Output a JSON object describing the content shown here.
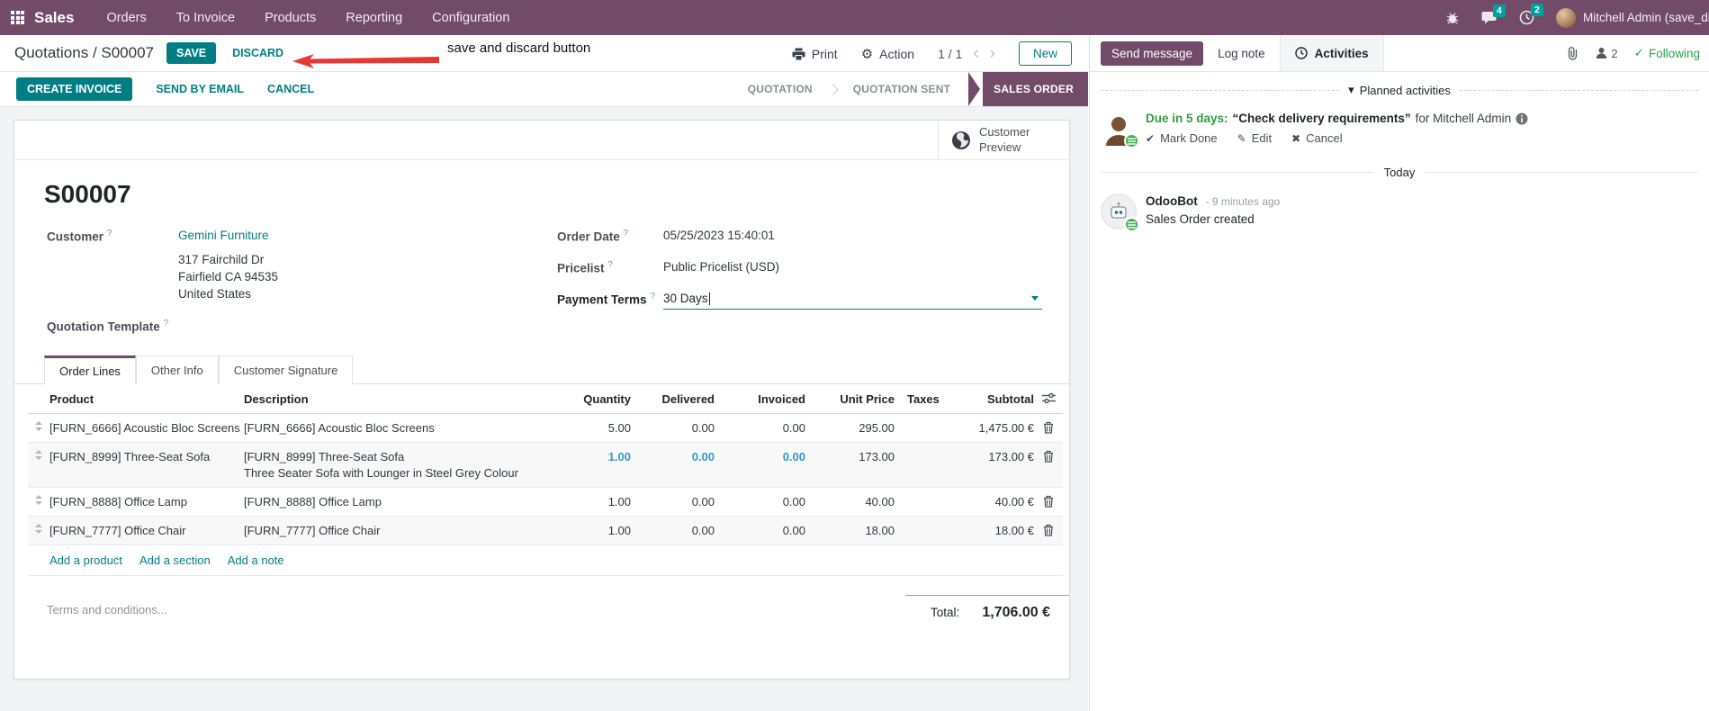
{
  "colors": {
    "brand": "#714B67",
    "primary": "#017E84",
    "success": "#28a745",
    "badge": "#00A09D",
    "edited_value": "#2E9DC6",
    "annotation": "#E53935"
  },
  "topnav": {
    "app": "Sales",
    "menus": [
      "Orders",
      "To Invoice",
      "Products",
      "Reporting",
      "Configuration"
    ],
    "message_badge": "4",
    "activity_badge": "2",
    "user": "Mitchell Admin (save_discar"
  },
  "control": {
    "breadcrumb": "Quotations / S00007",
    "save": "SAVE",
    "discard": "DISCARD",
    "annotation": "save and discard button",
    "print": "Print",
    "action": "Action",
    "pager": "1 / 1",
    "new": "New"
  },
  "actionbar": {
    "create_invoice": "CREATE INVOICE",
    "send_by_email": "SEND BY EMAIL",
    "cancel": "CANCEL",
    "stages": [
      "QUOTATION",
      "QUOTATION SENT",
      "SALES ORDER"
    ]
  },
  "form": {
    "preview_button": "Customer Preview",
    "title": "S00007",
    "customer": {
      "label": "Customer",
      "help": "?",
      "name": "Gemini Furniture",
      "address1": "317 Fairchild Dr",
      "address2": "Fairfield CA 94535",
      "address3": "United States"
    },
    "quotation_template": {
      "label": "Quotation Template",
      "help": "?"
    },
    "order_date": {
      "label": "Order Date",
      "help": "?",
      "value": "05/25/2023 15:40:01"
    },
    "pricelist": {
      "label": "Pricelist",
      "help": "?",
      "value": "Public Pricelist (USD)"
    },
    "payment_terms": {
      "label": "Payment Terms",
      "help": "?",
      "value": "30 Days"
    },
    "tabs": [
      "Order Lines",
      "Other Info",
      "Customer Signature"
    ],
    "table": {
      "headers": {
        "product": "Product",
        "description": "Description",
        "quantity": "Quantity",
        "delivered": "Delivered",
        "invoiced": "Invoiced",
        "unit_price": "Unit Price",
        "taxes": "Taxes",
        "subtotal": "Subtotal"
      },
      "rows": [
        {
          "product": "[FURN_6666] Acoustic Bloc Screens",
          "desc1": "[FURN_6666] Acoustic Bloc Screens",
          "desc2": "",
          "qty": "5.00",
          "delivered": "0.00",
          "invoiced": "0.00",
          "unit": "295.00",
          "taxes": "",
          "subtotal": "1,475.00 €"
        },
        {
          "product": "[FURN_8999] Three-Seat Sofa",
          "desc1": "[FURN_8999] Three-Seat Sofa",
          "desc2": "Three Seater Sofa with Lounger in Steel Grey Colour",
          "qty": "1.00",
          "delivered": "0.00",
          "invoiced": "0.00",
          "unit": "173.00",
          "taxes": "",
          "subtotal": "173.00 €"
        },
        {
          "product": "[FURN_8888] Office Lamp",
          "desc1": "[FURN_8888] Office Lamp",
          "desc2": "",
          "qty": "1.00",
          "delivered": "0.00",
          "invoiced": "0.00",
          "unit": "40.00",
          "taxes": "",
          "subtotal": "40.00 €"
        },
        {
          "product": "[FURN_7777] Office Chair",
          "desc1": "[FURN_7777] Office Chair",
          "desc2": "",
          "qty": "1.00",
          "delivered": "0.00",
          "invoiced": "0.00",
          "unit": "18.00",
          "taxes": "",
          "subtotal": "18.00 €"
        }
      ],
      "links": [
        "Add a product",
        "Add a section",
        "Add a note"
      ]
    },
    "terms_placeholder": "Terms and conditions...",
    "total_label": "Total:",
    "total_value": "1,706.00 €"
  },
  "chatter": {
    "send_message": "Send message",
    "log_note": "Log note",
    "activities": "Activities",
    "followers_count": "2",
    "following": "Following",
    "planned_title": "Planned activities",
    "activity": {
      "due": "Due in 5 days:",
      "summary": "“Check delivery requirements”",
      "assignee": "for Mitchell Admin",
      "mark_done": "Mark Done",
      "edit": "Edit",
      "cancel": "Cancel"
    },
    "today": "Today",
    "message": {
      "author": "OdooBot",
      "time": "- 9 minutes ago",
      "body": "Sales Order created"
    }
  }
}
